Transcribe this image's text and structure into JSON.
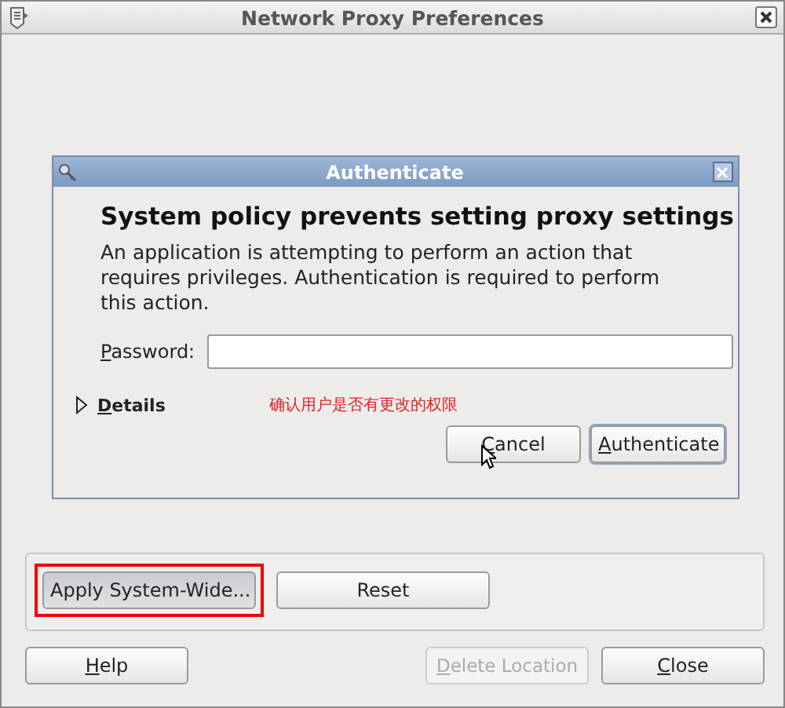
{
  "window": {
    "title": "Network Proxy Preferences"
  },
  "dialog": {
    "title": "Authenticate",
    "heading": "System policy prevents setting proxy settings",
    "message": "An application is attempting to perform an action that requires privileges. Authentication is required to perform this action.",
    "password": {
      "label": "Password:",
      "mnemonic": true
    },
    "details": {
      "label": "Details",
      "expanded": false,
      "mnemonic": true
    },
    "annotation": "确认用户是否有更改的权限",
    "buttons": [
      {
        "label": "Cancel",
        "mnemonic": true,
        "focused": false
      },
      {
        "label": "Authenticate",
        "mnemonic": true,
        "focused": true
      }
    ]
  },
  "panel_buttons": [
    {
      "label": "Apply System-Wide...",
      "pressed": true,
      "highlighted": true
    },
    {
      "label": "Reset",
      "pressed": false,
      "highlighted": false
    }
  ],
  "footer_buttons": [
    {
      "label": "Help",
      "mnemonic": true,
      "disabled": false
    },
    {
      "label": "Delete Location",
      "mnemonic": true,
      "disabled": true
    },
    {
      "label": "Close",
      "mnemonic": true,
      "disabled": false
    }
  ]
}
